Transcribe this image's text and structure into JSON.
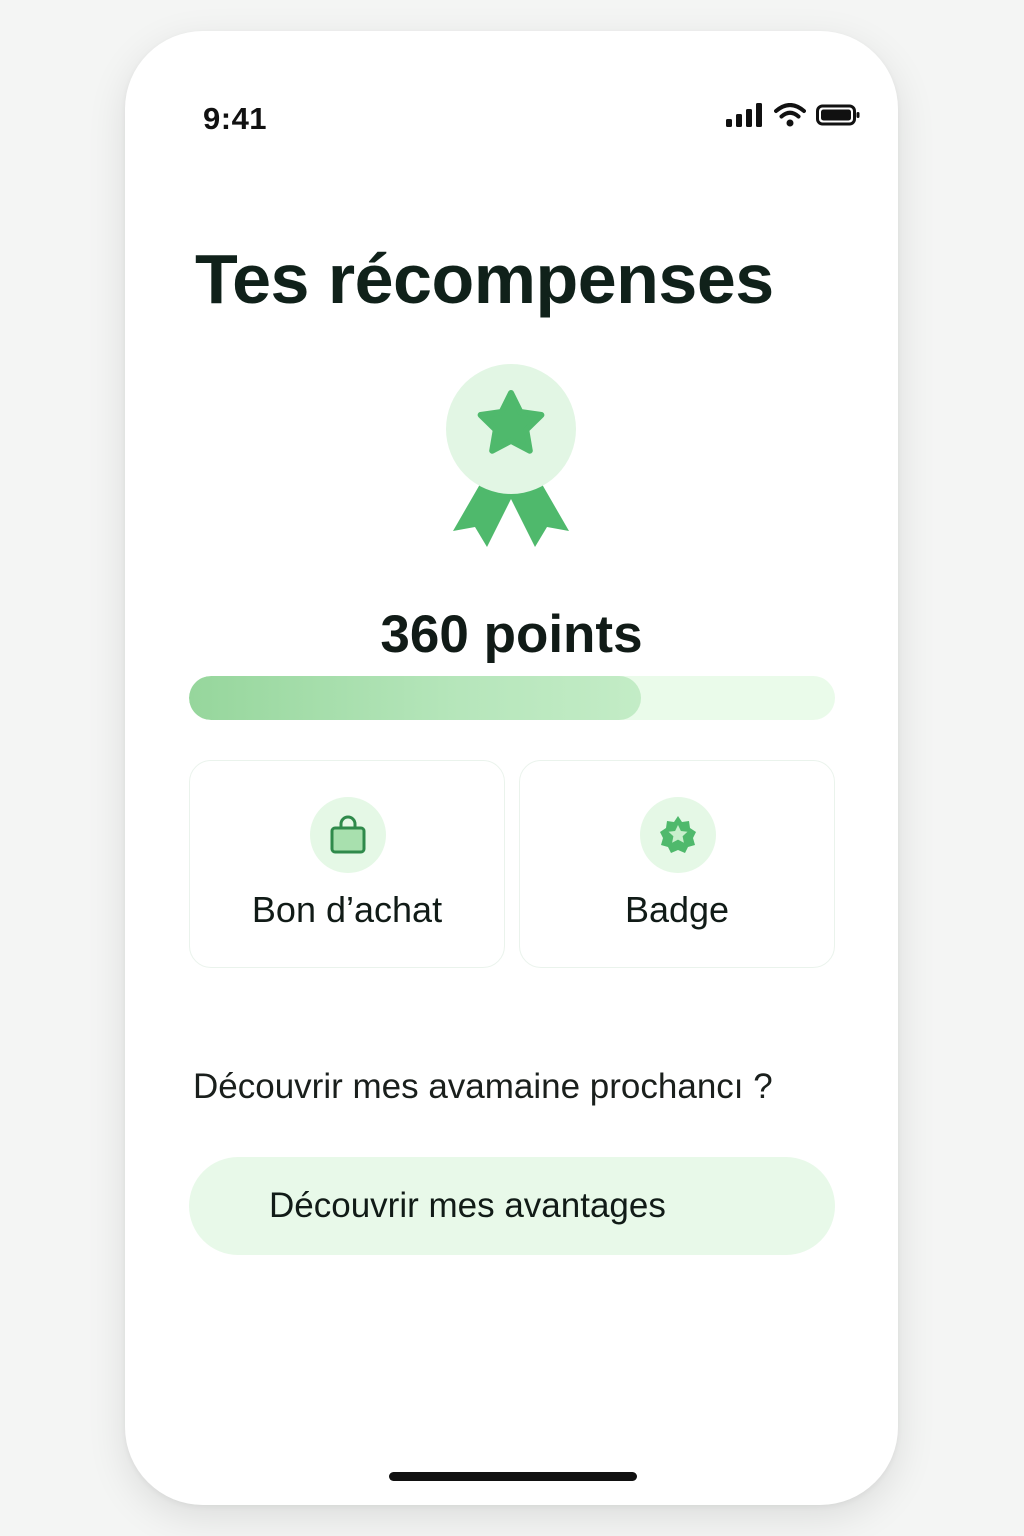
{
  "status_bar": {
    "time": "9:41",
    "icons": [
      "signal-icon",
      "wifi-icon",
      "battery-icon"
    ]
  },
  "page": {
    "title": "Tes récompenses"
  },
  "rewards": {
    "medal_icon": "medal-star-icon",
    "points_label": "360 points",
    "progress_fraction": 0.7
  },
  "cards": [
    {
      "label": "Bon d’achat",
      "icon": "shopping-bag-icon"
    },
    {
      "label": "Badge",
      "icon": "star-badge-icon"
    }
  ],
  "question": "Découvrir mes avamaine prochancı ?",
  "cta": {
    "label": "Découvrir mes avantages"
  },
  "colors": {
    "accent": "#4fb96c",
    "accent_light": "#e5f8e6",
    "progress_fill": "#a8e0ae",
    "progress_track": "#eafbea",
    "text": "#111b17"
  }
}
